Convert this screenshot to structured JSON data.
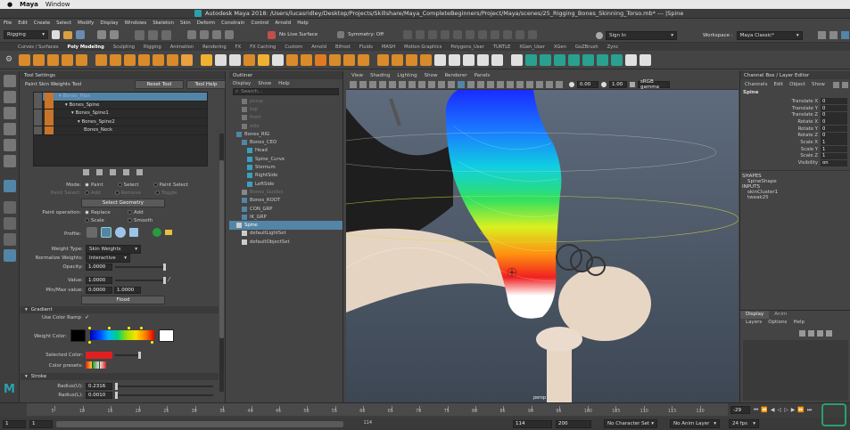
{
  "mac_menu": {
    "app": "Maya",
    "window": "Window"
  },
  "title": "Autodesk Maya 2018: /Users/lucasridley/Desktop/Projects/Skillshare/Maya_CompleteBeginners/Project/Maya/scenes/25_Rigging_Bones_Skinning_Torso.mb*  ---  |Spine",
  "menubar": [
    "File",
    "Edit",
    "Create",
    "Select",
    "Modify",
    "Display",
    "Windows",
    "Skeleton",
    "Skin",
    "Deform",
    "Constrain",
    "Control",
    "Arnold",
    "Help"
  ],
  "status": {
    "mode": "Rigging",
    "no_live_surface": "No Live Surface",
    "symmetry": "Symmetry: Off",
    "workspace_label": "Workspace :",
    "workspace": "Maya Classic*",
    "sign_in": "Sign In"
  },
  "shelf_tabs": [
    "Curves / Surfaces",
    "Poly Modeling",
    "Sculpting",
    "Rigging",
    "Animation",
    "Rendering",
    "FX",
    "FX Caching",
    "Custom",
    "Arnold",
    "Bifrost",
    "Fluids",
    "MASH",
    "Motion Graphics",
    "Polygons_User",
    "TURTLE",
    "XGen_User",
    "XGen",
    "GoZBrush",
    "Zync"
  ],
  "shelf_active_tab": "Poly Modeling",
  "shelf_icon_colors": [
    "#d98a2a",
    "#d98a2a",
    "#d98a2a",
    "#d98a2a",
    "#d98a2a",
    "#d98a2a",
    "#d98a2a",
    "#d98a2a",
    "#d98a2a",
    "#d98a2a",
    "#d98a2a",
    "#e8a040",
    "#f0b030",
    "#dddddd",
    "#dddddd",
    "#d98a2a",
    "#f0b030",
    "#e0e0e0",
    "#d98a2a",
    "#d98a2a",
    "#e07a20",
    "#d98a2a",
    "#d98a2a",
    "#d98a2a",
    "#d98a2a",
    "#d98a2a",
    "#d98a2a",
    "#d98a2a",
    "#e0e0e0",
    "#e0e0e0",
    "#e0e0e0",
    "#e0e0e0",
    "#e0e0e0",
    "#e0e0e0",
    "#2aa090",
    "#2aa090",
    "#2aa090",
    "#2aa090",
    "#2aa090",
    "#2aa090",
    "#2aa090",
    "#e0e0e0",
    "#e0e0e0"
  ],
  "tool_settings": {
    "header": "Tool Settings",
    "tool_name": "Paint Skin Weights Tool",
    "reset_tool": "Reset Tool",
    "tool_help": "Tool Help",
    "influences": [
      "Bones_Hips",
      "Bones_Spine",
      "Bones_Spine1",
      "Bones_Spine2",
      "Bones_Neck"
    ],
    "mode_label": "Mode:",
    "mode_options": [
      "Paint",
      "Select",
      "Paint Select"
    ],
    "paint_select_label": "Paint Select:",
    "paint_select_options": [
      "Add",
      "Remove",
      "Toggle"
    ],
    "select_geometry": "Select Geometry",
    "paint_operation_label": "Paint operation:",
    "paint_operations": [
      "Replace",
      "Add",
      "Scale",
      "Smooth"
    ],
    "profile_label": "Profile:",
    "weight_type_label": "Weight Type:",
    "weight_type": "Skin Weights",
    "normalize_label": "Normalize Weights:",
    "normalize": "Interactive",
    "opacity_label": "Opacity:",
    "opacity": "1.0000",
    "value_label": "Value:",
    "value": "1.0000",
    "minmax_label": "Min/Max value:",
    "min": "0.0000",
    "max": "1.0000",
    "flood": "Flood",
    "gradient_section": "Gradient",
    "use_color_ramp": "Use Color Ramp",
    "weight_color_label": "Weight Color:",
    "selected_color_label": "Selected Color:",
    "color_presets_label": "Color presets:",
    "stroke_section": "Stroke",
    "radius_u_label": "Radius(U):",
    "radius_u": "0.2316",
    "radius_l_label": "Radius(L):",
    "radius_l": "0.0010"
  },
  "outliner": {
    "header": "Outliner",
    "menu": [
      "Display",
      "Show",
      "Help"
    ],
    "search_placeholder": "Search...",
    "items": [
      "persp",
      "top",
      "front",
      "side",
      "Bones_RIG",
      "Bones_CEO",
      "Head",
      "Spine_Curve",
      "Sternum",
      "RightSide",
      "LeftSide",
      "Bones_Guides",
      "Bones_ROOT",
      "CON_GRP",
      "IK_GRP",
      "Spine",
      "defaultLightSet",
      "defaultObjectSet"
    ],
    "selected": "Spine"
  },
  "viewport": {
    "menu": [
      "View",
      "Shading",
      "Lighting",
      "Show",
      "Renderer",
      "Panels"
    ],
    "field1": "0.00",
    "field2": "1.00",
    "colorspace": "sRGB gamma",
    "camera_label": "persp"
  },
  "channel_box": {
    "header": "Channel Box / Layer Editor",
    "menu": [
      "Channels",
      "Edit",
      "Object",
      "Show"
    ],
    "object": "Spine",
    "channels": [
      {
        "name": "Translate X",
        "value": "0"
      },
      {
        "name": "Translate Y",
        "value": "0"
      },
      {
        "name": "Translate Z",
        "value": "0"
      },
      {
        "name": "Rotate X",
        "value": "0"
      },
      {
        "name": "Rotate Y",
        "value": "0"
      },
      {
        "name": "Rotate Z",
        "value": "0"
      },
      {
        "name": "Scale X",
        "value": "1"
      },
      {
        "name": "Scale Y",
        "value": "1"
      },
      {
        "name": "Scale Z",
        "value": "1"
      },
      {
        "name": "Visibility",
        "value": "on"
      }
    ],
    "shapes_label": "SHAPES",
    "shape": "SpineShape",
    "inputs_label": "INPUTS",
    "inputs": [
      "skinCluster1",
      "tweak25"
    ]
  },
  "layer_editor": {
    "tabs": [
      "Display",
      "Anim"
    ],
    "menu": [
      "Layers",
      "Options",
      "Help"
    ]
  },
  "timeline": {
    "ticks": [
      "5",
      "10",
      "15",
      "20",
      "25",
      "30",
      "35",
      "40",
      "45",
      "50",
      "55",
      "60",
      "65",
      "70",
      "75",
      "80",
      "85",
      "90",
      "95",
      "100",
      "105",
      "110",
      "115",
      "120"
    ],
    "current_frame": "-29",
    "start": "1",
    "start2": "1",
    "range_end": "114",
    "end": "114",
    "end2": "200",
    "no_character_set": "No Character Set",
    "no_anim_layer": "No Anim Layer",
    "fps": "24 fps"
  },
  "colors": {
    "accent": "#5285a6",
    "selection": "#5285a6",
    "influence_swatch": "#c8742a"
  }
}
